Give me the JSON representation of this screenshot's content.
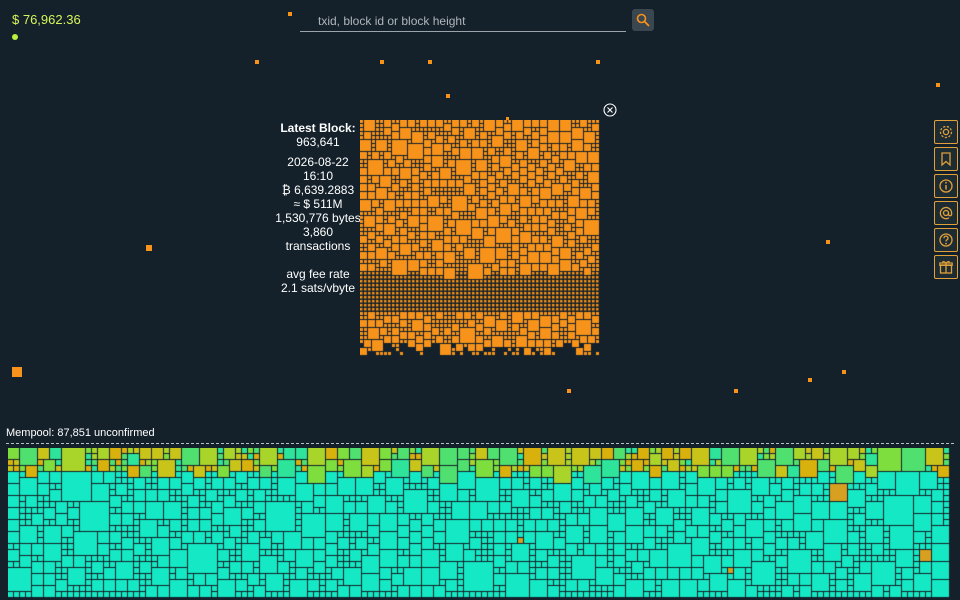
{
  "header": {
    "price": "$ 76,962.36",
    "search_placeholder": "txid, block id or block height",
    "search_icon": "magnifier-icon"
  },
  "sidebar": {
    "items": [
      {
        "name": "settings",
        "icon": "gear-icon"
      },
      {
        "name": "bookmark",
        "icon": "bookmark-icon"
      },
      {
        "name": "info",
        "icon": "info-icon"
      },
      {
        "name": "contact",
        "icon": "at-sign-icon"
      },
      {
        "name": "help",
        "icon": "question-icon"
      },
      {
        "name": "gift",
        "icon": "gift-icon"
      }
    ]
  },
  "block": {
    "title": "Latest Block:",
    "height": "963,641",
    "timestamp": "2026-08-22 16:10",
    "btc_amount": "₿ 6,639.2883",
    "usd_value": "≈ $ 511M",
    "size": "1,530,776 bytes",
    "tx_count": "3,860 transactions",
    "fee_label": "avg fee rate",
    "fee_value": "2.1 sats/vbyte",
    "close_icon": "close-circle-icon"
  },
  "mempool": {
    "label": "Mempool: 87,851 unconfirmed"
  },
  "colors": {
    "background": "#14212a",
    "block_tx": "#f7931a",
    "mempool_low_fee": "#14e8c4",
    "mempool_high_fee": "#d8b10c",
    "accent_price": "#d6f55a"
  }
}
